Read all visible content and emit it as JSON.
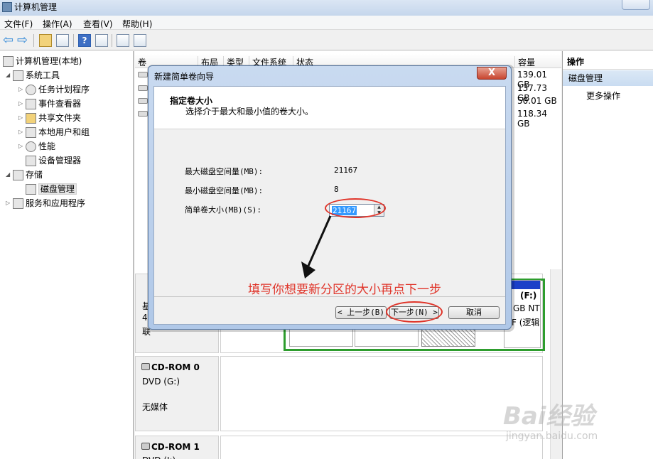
{
  "window": {
    "title": "计算机管理"
  },
  "menu": [
    "文件(F)",
    "操作(A)",
    "查看(V)",
    "帮助(H)"
  ],
  "tree": {
    "root": "计算机管理(本地)",
    "system_tools": "系统工具",
    "task_scheduler": "任务计划程序",
    "event_viewer": "事件查看器",
    "shared_folders": "共享文件夹",
    "local_users": "本地用户和组",
    "performance": "性能",
    "device_manager": "设备管理器",
    "storage": "存储",
    "disk_management": "磁盘管理",
    "services_apps": "服务和应用程序"
  },
  "columns": [
    "卷",
    "布局",
    "类型",
    "文件系统",
    "状态",
    "容量"
  ],
  "volumes": [
    {
      "capacity": "139.01 GB"
    },
    {
      "capacity": "137.73 GB"
    },
    {
      "capacity": "50.01 GB"
    },
    {
      "capacity": "118.34 GB"
    }
  ],
  "disk_graph": {
    "disk0_partial": [
      "基",
      "4",
      "联"
    ],
    "partition_f": {
      "label": "(F:)",
      "line2": "GB NT",
      "line3": "F (逻辑"
    },
    "cdrom0": {
      "name": "CD-ROM 0",
      "type": "DVD (G:)",
      "status": "无媒体"
    },
    "cdrom1": {
      "name": "CD-ROM 1",
      "type": "DVD (I:)"
    }
  },
  "actions": {
    "header": "操作",
    "section": "磁盘管理",
    "more": "更多操作"
  },
  "dialog": {
    "title": "新建简单卷向导",
    "close": "X",
    "heading": "指定卷大小",
    "subheading": "选择介于最大和最小值的卷大小。",
    "max_label": "最大磁盘空间量(MB):",
    "max_value": "21167",
    "min_label": "最小磁盘空间量(MB):",
    "min_value": "8",
    "size_label": "简单卷大小(MB)(S):",
    "size_value": "21167",
    "back": "< 上一步(B)",
    "next": "下一步(N) >",
    "cancel": "取消"
  },
  "annotation": "填写你想要新分区的大小再点下一步",
  "colors": {
    "annotation": "#e0352a",
    "selection": "#3399ff",
    "partition_border": "#2e9d2e",
    "partition_header": "#1a3fc8"
  },
  "watermark": {
    "logo": "Bai经验",
    "url": "jingyan.baidu.com"
  }
}
